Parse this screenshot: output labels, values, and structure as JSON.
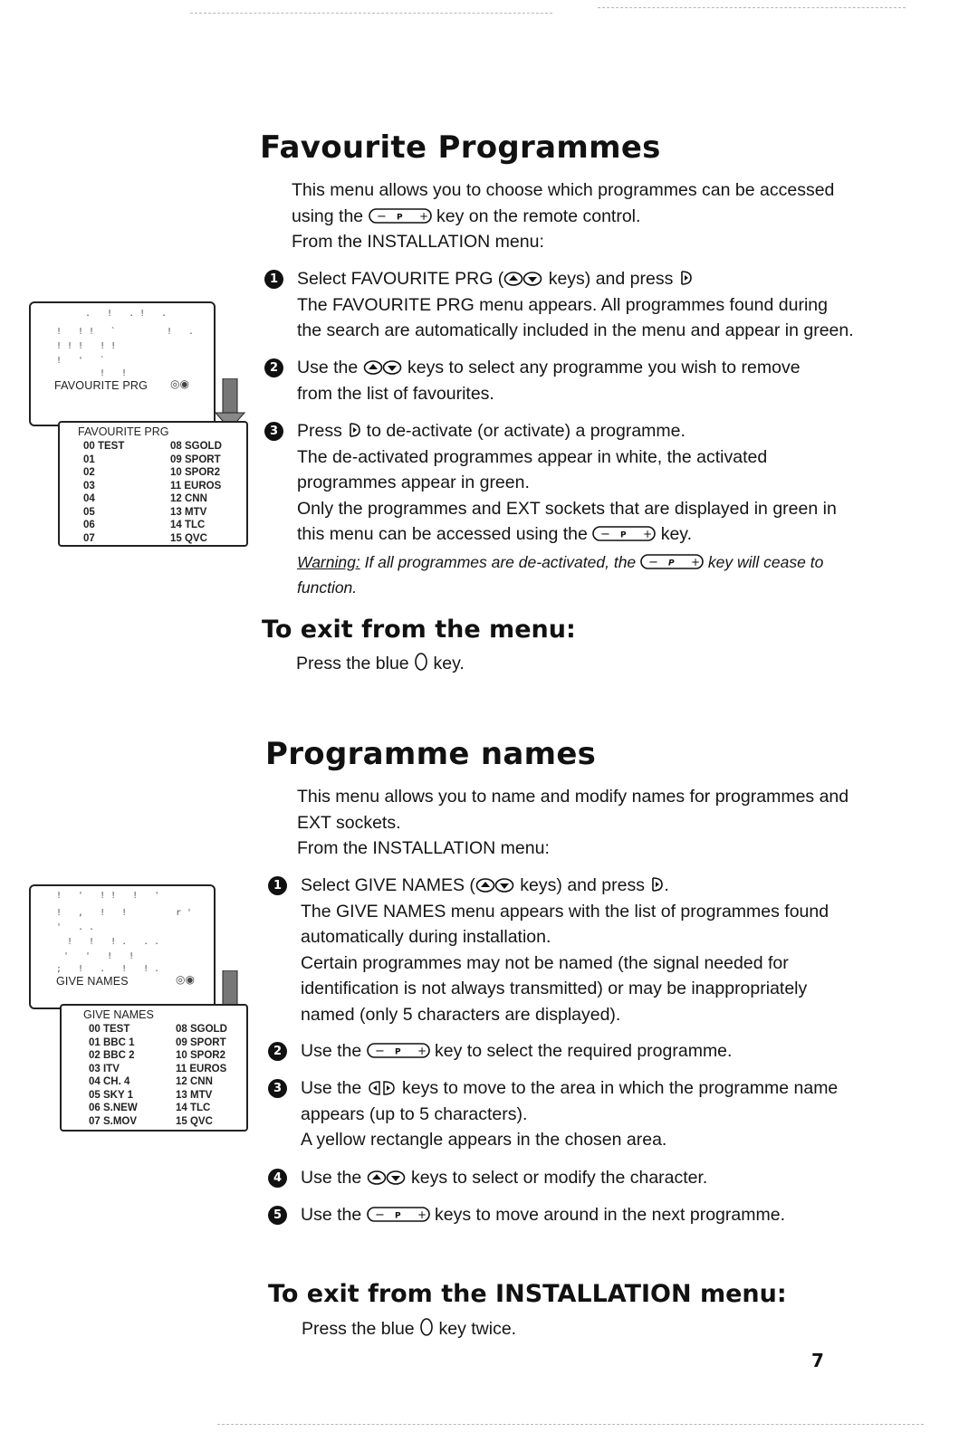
{
  "page_number": "7",
  "section1": {
    "title": "Favourite Programmes",
    "intro_lines": [
      "This menu allows you to choose which programmes can be accessed",
      [
        "using the ",
        "key-p",
        " key on the remote control."
      ],
      "From the INSTALLATION menu:"
    ],
    "steps": [
      {
        "number": "1",
        "lines": [
          [
            "Select FAVOURITE PRG (",
            "key-updown",
            " keys) and press ",
            "key-right"
          ],
          "The FAVOURITE PRG menu appears. All programmes found during",
          "the search are automatically included in the menu and appear in green."
        ]
      },
      {
        "number": "2",
        "lines": [
          [
            "Use the ",
            "key-updown",
            " keys to select any programme you wish to remove"
          ],
          "from the list of favourites."
        ]
      },
      {
        "number": "3",
        "lines": [
          [
            "Press ",
            "key-right",
            " to de-activate (or activate) a programme."
          ],
          "The de-activated programmes appear in white, the activated",
          "programmes appear in green.",
          "Only the programmes and EXT sockets that are displayed in green in",
          [
            "this menu can be accessed using the ",
            "key-p",
            " key."
          ]
        ],
        "warning": {
          "label": "Warning:",
          "line1_pre": " If all programmes are de-activated, the ",
          "line1_post": " key will cease to",
          "line2": "function."
        }
      }
    ],
    "exit_title": "To exit from the menu:",
    "exit_text_pre": "Press the blue ",
    "exit_text_post": " key.",
    "screen": {
      "tv_label": "FAVOURITE PRG",
      "menu_title": "FAVOURITE PRG",
      "left_column": [
        "00 TEST",
        "01",
        "02",
        "03",
        "04",
        "05",
        "06",
        "07"
      ],
      "right_column": [
        "08 SGOLD",
        "09 SPORT",
        "10 SPOR2",
        "11 EUROS",
        "12 CNN",
        "13 MTV",
        "14 TLC",
        "15 QVC"
      ]
    }
  },
  "section2": {
    "title": "Programme names",
    "intro_lines": [
      "This menu allows you to name and modify names for programmes and",
      "EXT sockets.",
      "From the INSTALLATION menu:"
    ],
    "steps": [
      {
        "number": "1",
        "lines": [
          [
            "Select GIVE NAMES (",
            "key-updown",
            " keys) and press ",
            "key-right",
            "."
          ],
          "The GIVE NAMES menu appears with the list of programmes found",
          "automatically during installation.",
          "Certain programmes may not be named (the signal needed for",
          "identification is not always transmitted) or may be inappropriately",
          "named (only 5 characters are displayed)."
        ]
      },
      {
        "number": "2",
        "lines": [
          [
            "Use the ",
            "key-p",
            " key to select the required programme."
          ]
        ]
      },
      {
        "number": "3",
        "lines": [
          [
            "Use the ",
            "key-leftright",
            " keys to move to the area in which the programme name"
          ],
          "appears (up to 5 characters).",
          "A yellow rectangle appears in the chosen area."
        ]
      },
      {
        "number": "4",
        "lines": [
          [
            "Use the ",
            "key-updown",
            " keys to select or modify the character."
          ]
        ]
      },
      {
        "number": "5",
        "lines": [
          [
            "Use the ",
            "key-p",
            " keys to move around in the next programme."
          ]
        ]
      }
    ],
    "exit_title": "To exit from the INSTALLATION menu:",
    "exit_text_pre": "Press the blue ",
    "exit_text_post": " key twice.",
    "screen": {
      "tv_label": "GIVE NAMES",
      "menu_title": "GIVE NAMES",
      "left_column": [
        "00 TEST",
        "01 BBC 1",
        "02 BBC 2",
        "03 ITV",
        "04 CH. 4",
        "05 SKY 1",
        "06 S.NEW",
        "07 S.MOV"
      ],
      "right_column": [
        "08 SGOLD",
        "09 SPORT",
        "10 SPOR2",
        "11 EUROS",
        "12 CNN",
        "13 MTV",
        "14 TLC",
        "15 QVC"
      ]
    }
  },
  "icons": {
    "key-p": "p-minus-plus-key-icon",
    "key-updown": "up-down-keys-icon",
    "key-right": "right-key-icon",
    "key-leftright": "left-right-keys-icon",
    "key-blue": "blue-circle-key-icon",
    "key-p-letter": "P"
  }
}
